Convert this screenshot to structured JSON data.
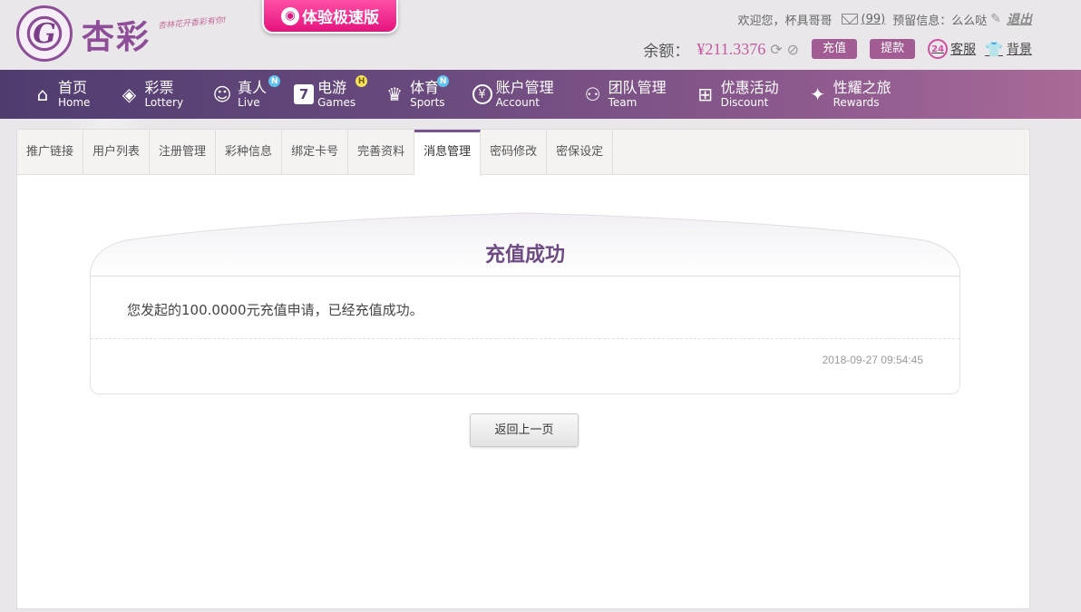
{
  "header": {
    "logo_text": "杏彩",
    "logo_slogan": "杏林花开香彩有你!",
    "speed_badge": "体验极速版",
    "welcome": "欢迎您，",
    "username": "杯具哥哥",
    "msg_count": "(99)",
    "reserve_label": "预留信息：",
    "reserve_value": "么么哒",
    "logout": "退出",
    "balance_label": "余额：",
    "balance_value": "¥211.3376",
    "recharge": "充值",
    "withdraw": "提款",
    "service": "客服",
    "service_badge": "24",
    "background": "背景"
  },
  "nav": [
    {
      "zh": "首页",
      "en": "Home"
    },
    {
      "zh": "彩票",
      "en": "Lottery"
    },
    {
      "zh": "真人",
      "en": "Live",
      "badge": "N"
    },
    {
      "zh": "电游",
      "en": "Games",
      "badge": "H"
    },
    {
      "zh": "体育",
      "en": "Sports",
      "badge": "N"
    },
    {
      "zh": "账户管理",
      "en": "Account"
    },
    {
      "zh": "团队管理",
      "en": "Team"
    },
    {
      "zh": "优惠活动",
      "en": "Discount"
    },
    {
      "zh": "性耀之旅",
      "en": "Rewards"
    }
  ],
  "tabs": [
    "推广链接",
    "用户列表",
    "注册管理",
    "彩种信息",
    "绑定卡号",
    "完善资料",
    "消息管理",
    "密码修改",
    "密保设定"
  ],
  "active_tab_index": 6,
  "notice": {
    "title": "充值成功",
    "message": "您发起的100.0000元充值申请，已经充值成功。",
    "time": "2018-09-27 09:54:45"
  },
  "back_button": "返回上一页"
}
